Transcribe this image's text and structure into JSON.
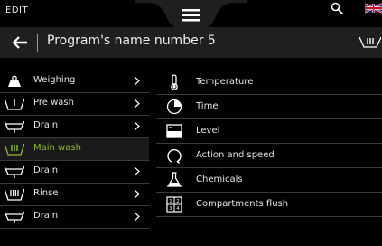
{
  "topbar": {
    "mode_label": "EDIT",
    "icons": {
      "menu": "hamburger-menu-icon",
      "search": "search-icon",
      "language": "uk-flag-icon"
    }
  },
  "header": {
    "back_icon": "back-arrow-icon",
    "program_name": "Program's name number 5",
    "program_icon": "main-wash-icon"
  },
  "colors": {
    "active": "#8cbd2a",
    "background": "#000000",
    "header": "#1f1f1f"
  },
  "phases": [
    {
      "label": "Weighing",
      "icon": "weighing-icon",
      "active": false,
      "has_chevron": true
    },
    {
      "label": "Pre wash",
      "icon": "pre-wash-icon",
      "active": false,
      "has_chevron": true
    },
    {
      "label": "Drain",
      "icon": "drain-icon",
      "active": false,
      "has_chevron": true
    },
    {
      "label": "Main wash",
      "icon": "main-wash-icon",
      "active": true,
      "has_chevron": false
    },
    {
      "label": "Drain",
      "icon": "drain-icon",
      "active": false,
      "has_chevron": true
    },
    {
      "label": "Rinse",
      "icon": "rinse-icon",
      "active": false,
      "has_chevron": true
    },
    {
      "label": "Drain",
      "icon": "drain-icon",
      "active": false,
      "has_chevron": true
    }
  ],
  "settings": [
    {
      "label": "Temperature",
      "icon": "thermometer-icon"
    },
    {
      "label": "Time",
      "icon": "timer-icon"
    },
    {
      "label": "Level",
      "icon": "level-icon"
    },
    {
      "label": "Action and speed",
      "icon": "rotation-icon"
    },
    {
      "label": "Chemicals",
      "icon": "flask-icon"
    },
    {
      "label": "Compartments flush",
      "icon": "compartments-icon"
    }
  ]
}
